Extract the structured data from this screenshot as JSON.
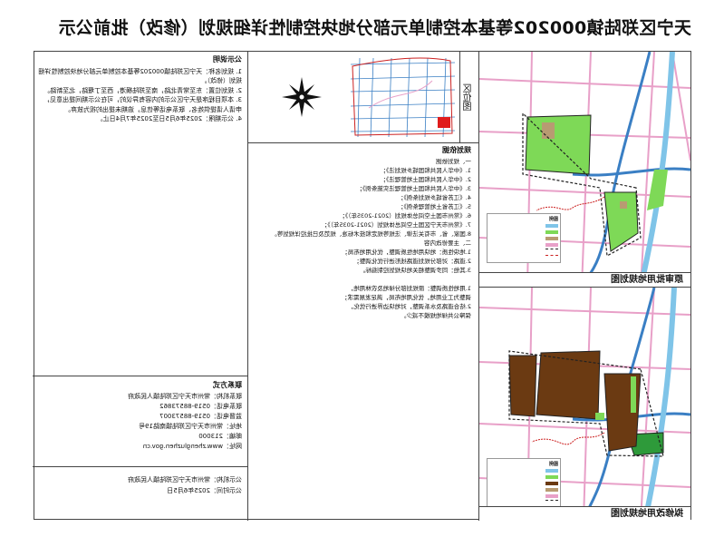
{
  "title": "天宁区郑陆镇000202等基本控制单元部分地块控制性详细规划（修改）批前公示",
  "maps": {
    "original": {
      "caption": "原审批用地规划图"
    },
    "revised": {
      "caption": "拟修改用地规划图"
    },
    "legend_title": "图例",
    "colors": {
      "water": "#7fc4e8",
      "green": "#7ed957",
      "brown": "#6b3a12",
      "tan": "#b89b72",
      "road_pink": "#e8a0c8",
      "boundary": "#222222",
      "red_line": "#cc2222",
      "blue_canal": "#3a7fc4"
    }
  },
  "location": {
    "label": "区位图"
  },
  "notice": {
    "heading": "公示说明",
    "items": [
      "1. 规划名称：天宁区郑陆镇000202等基本控制单元部分地块控制性详细规划（修改）。",
      "2. 规划位置：东至常青北路，南至郑陆横港，西至丁堰路，北至新路。",
      "3. 本项目程序是天宁区公示的内容有异议的，可在公示期间提出意见，申请人请提供姓名、联系电话等信息，逾期未提出的视为放弃。",
      "4. 公示期限：2025年6月5日至2025年7月4日止。"
    ]
  },
  "planning": {
    "heading": "规划依据",
    "lines": [
      "一、规划依据",
      "1.《中华人民共和国城乡规划法》；",
      "2.《中华人民共和国土地管理法》；",
      "3.《中华人民共和国土地管理法实施条例》；",
      "4.《江苏省城乡规划条例》；",
      "5.《江苏省土地管理条例》；",
      "6.《常州市国土空间总体规划（2021-2035年）》；",
      "7.《常州市天宁区国土空间总体规划（2021-2035年）》；",
      "8.国家、省、市有关法律、法规等规定和技术标准、规范及已批控详规划等。",
      "二、主要修改内容",
      "1.地块性质：地块用地性质调整，优化用地布局；",
      "2.道路：对部分规划道路线形进行优化调整；",
      "3.其他：同步调整相关地块规划控制指标。",
      "",
      "1.用地性质调整：原规划部分绿地及农林用地，",
      "调整为工业用地，优化用地布局，满足发展需求；",
      "2.结合道路及水系调整，对地块边界进行优化，",
      "保障公共绿地规模不减少。"
    ]
  },
  "contact": {
    "heading": "联系方式",
    "lines": [
      "联系机构：常州市天宁区郑陆镇人民政府",
      "联系电话：0519-88573862",
      "监督电话：0519-88573007",
      "地址：常州市天宁区郑陆镇南路19号",
      "邮编：213000",
      "网址：www.zhengluzhen.gov.cn"
    ]
  },
  "issuer": {
    "lines": [
      "公示机构：常州市天宁区郑陆镇人民政府",
      "公示时间：2025年6月5日"
    ]
  }
}
